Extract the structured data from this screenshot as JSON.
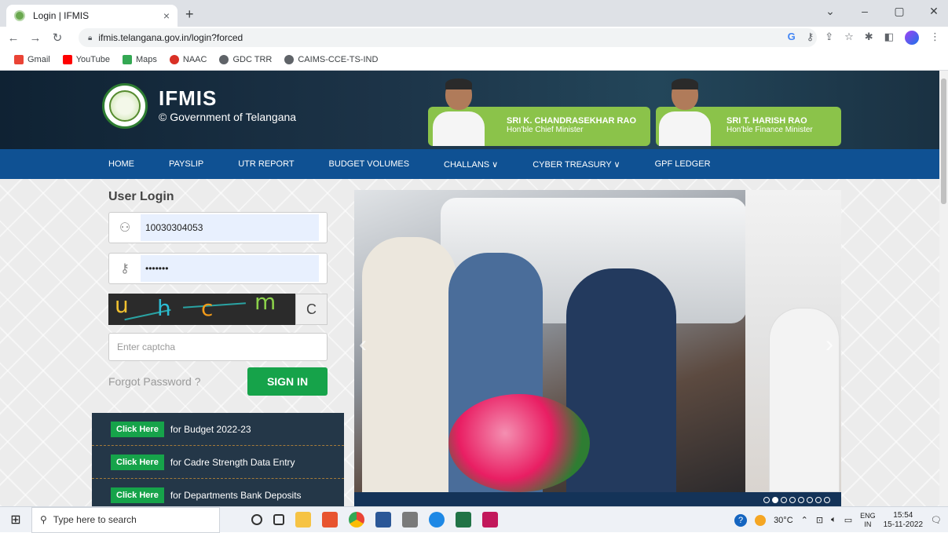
{
  "browser": {
    "tab_title": "Login | IFMIS",
    "tab_close": "×",
    "new_tab": "+",
    "url": "ifmis.telangana.gov.in/login?forced",
    "window_controls": [
      "⌄",
      "–",
      "▢",
      "✕"
    ],
    "bookmarks": [
      {
        "label": "Gmail",
        "color": "#ea4335"
      },
      {
        "label": "YouTube",
        "color": "#ff0000"
      },
      {
        "label": "Maps",
        "color": "#34a853"
      },
      {
        "label": "NAAC",
        "color": "#d93025"
      },
      {
        "label": "GDC TRR",
        "color": "#5f6368"
      },
      {
        "label": "CAIMS-CCE-TS-IND",
        "color": "#5f6368"
      }
    ]
  },
  "header": {
    "brand_name": "IFMIS",
    "brand_sub": "© Government of Telangana",
    "cm_name": "SRI K. CHANDRASEKHAR RAO",
    "cm_role": "Hon'ble Chief Minister",
    "fm_name": "SRI T. HARISH RAO",
    "fm_role": "Hon'ble Finance Minister"
  },
  "nav": {
    "home": "HOME",
    "payslip": "PAYSLIP",
    "utr": "UTR REPORT",
    "budget": "BUDGET VOLUMES",
    "challans": "CHALLANS ∨",
    "cyber": "CYBER TREASURY ∨",
    "gpf": "GPF LEDGER"
  },
  "login": {
    "title": "User Login",
    "username": "10030304053",
    "password": "•••••••",
    "captcha_chars": [
      "u",
      "h",
      "c",
      "m"
    ],
    "refresh": "C",
    "captcha_placeholder": "Enter captcha",
    "forgot": "Forgot Password ?",
    "signin": "SIGN IN"
  },
  "links": [
    {
      "button": "Click Here",
      "label": "for Budget 2022-23"
    },
    {
      "button": "Click Here",
      "label": "for Cadre Strength Data Entry"
    },
    {
      "button": "Click Here",
      "label": "for Departments Bank Deposits"
    }
  ],
  "carousel": {
    "prev": "‹",
    "next": "›",
    "slides_total": 8,
    "active_slide": 2
  },
  "taskbar": {
    "search_placeholder": "Type here to search",
    "weather": "30°C",
    "lang_top": "ENG",
    "lang_bottom": "IN",
    "time": "15:54",
    "date": "15-11-2022"
  }
}
